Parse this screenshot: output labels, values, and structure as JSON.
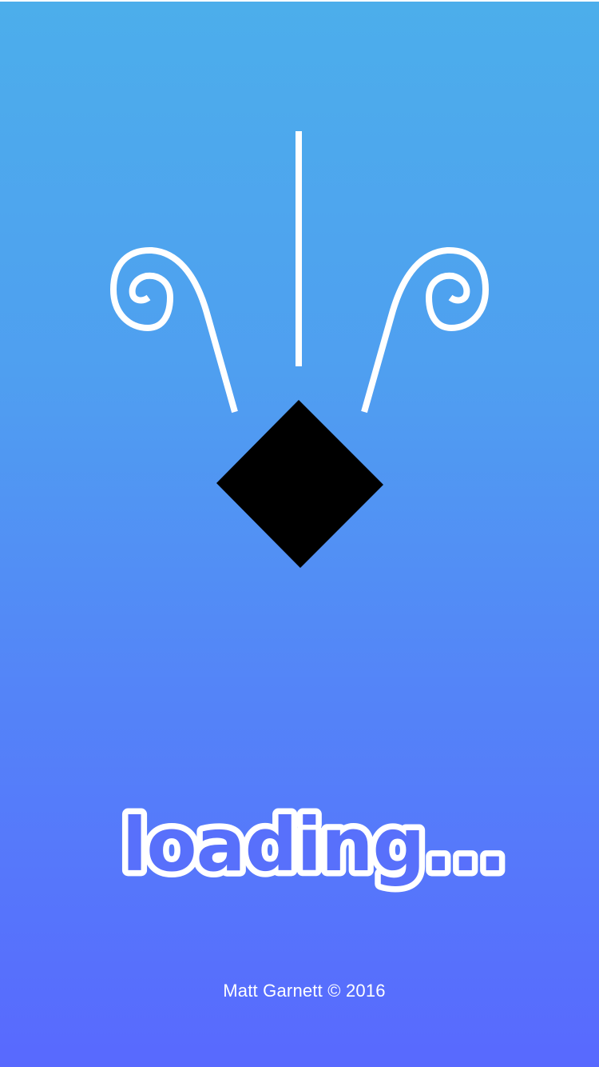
{
  "splash": {
    "loading_text": "loading...",
    "copyright": "Matt Garnett © 2016"
  },
  "colors": {
    "background_top": "#4caeeb",
    "background_bottom": "#5869fe",
    "stroke": "#ffffff",
    "diamond": "#000000"
  },
  "icons": {
    "logo": "diamond-with-stem-and-spiral-horns",
    "left_spiral": "left-spiral-horn-icon",
    "right_spiral": "right-spiral-horn-icon",
    "stem": "vertical-stem-line",
    "diamond": "black-diamond-shape"
  }
}
